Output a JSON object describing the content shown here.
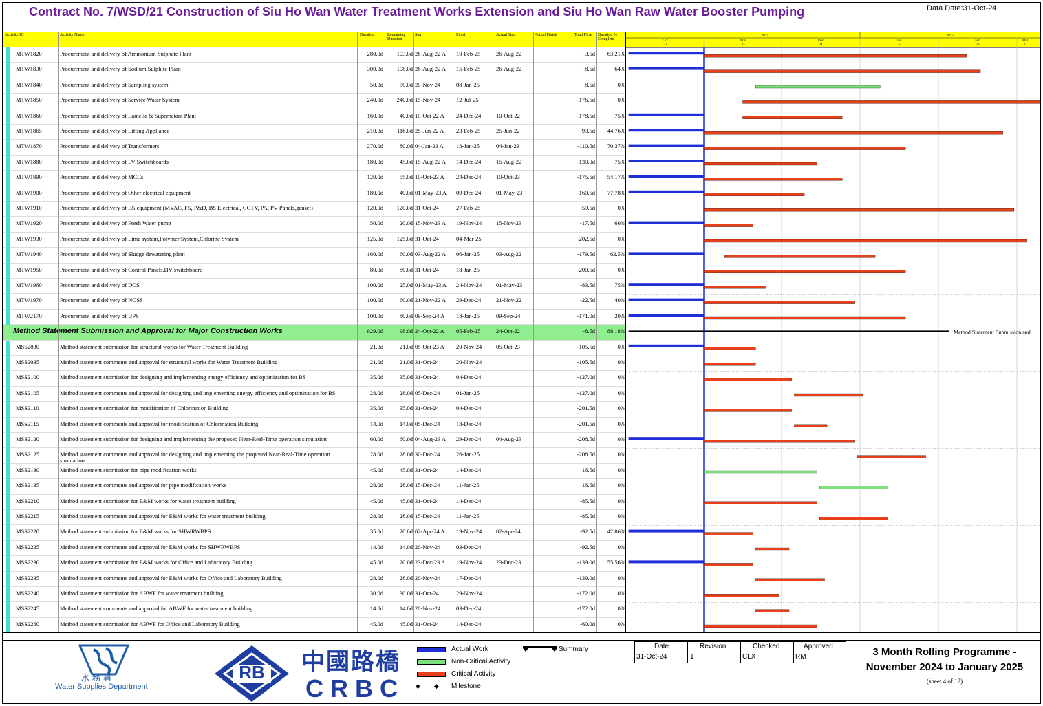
{
  "title": "Contract No. 7/WSD/21 Construction of Siu Ho Wan Water Treatment Works Extension and Siu Ho Wan Raw Water Booster Pumping",
  "data_date": "Data Date:31-Oct-24",
  "columns": [
    "Activity ID",
    "Activity Name",
    "Duration",
    "Remaining Duration",
    "Start",
    "Finish",
    "Actual Start",
    "Actual Finish",
    "Total Float",
    "Duration % Complete"
  ],
  "timescale": {
    "years": [
      "2024",
      "2025"
    ],
    "months": [
      "Oct",
      "Nov",
      "Dec",
      "Jan",
      "Feb",
      "Mar"
    ],
    "weeks": [
      "32",
      "33",
      "34",
      "35",
      "36",
      "37"
    ],
    "month_edges": [
      "30-Sep-24",
      "31-Oct-24",
      "30-Nov-24",
      "31-Dec-24",
      "31-Jan-25",
      "28-Feb-25",
      "31-Mar-25"
    ]
  },
  "rows": [
    {
      "id": "MTW1820",
      "name": "Procurement and delivery of Ammonium Sulphate Plant",
      "dur": "280.0d",
      "rem": "103.0d",
      "start": "26-Aug-22 A",
      "finish": "10-Feb-25",
      "astart": "26-Aug-22",
      "afin": "",
      "float": "-3.5d",
      "pct": "63.21%",
      "a_start": "1-Oct-24",
      "a_end": "31-Oct-24",
      "b_start": "31-Oct-24",
      "b_end": "10-Feb-25",
      "kind": "critical"
    },
    {
      "id": "MTW1830",
      "name": "Procurement and delivery of Sodium Sulphite Plant",
      "dur": "300.0d",
      "rem": "108.0d",
      "start": "26-Aug-22 A",
      "finish": "15-Feb-25",
      "astart": "26-Aug-22",
      "afin": "",
      "float": "-8.5d",
      "pct": "64%",
      "a_start": "1-Oct-24",
      "a_end": "31-Oct-24",
      "b_start": "31-Oct-24",
      "b_end": "15-Feb-25",
      "kind": "critical"
    },
    {
      "id": "MTW1840",
      "name": "Procurement and delivery of Sampling system",
      "dur": "50.0d",
      "rem": "50.0d",
      "start": "20-Nov-24",
      "finish": "08-Jan-25",
      "astart": "",
      "afin": "",
      "float": "8.5d",
      "pct": "0%",
      "a_start": "",
      "a_end": "",
      "b_start": "20-Nov-24",
      "b_end": "08-Jan-25",
      "kind": "noncritical"
    },
    {
      "id": "MTW1850",
      "name": "Procurement and delivery of Service Water System",
      "dur": "240.0d",
      "rem": "240.0d",
      "start": "15-Nov-24",
      "finish": "12-Jul-25",
      "astart": "",
      "afin": "",
      "float": "-176.5d",
      "pct": "0%",
      "a_start": "",
      "a_end": "",
      "b_start": "15-Nov-24",
      "b_end": "12-Jul-25",
      "kind": "critical"
    },
    {
      "id": "MTW1860",
      "name": "Procurement and delivery of Lamella & Supernatant Plant",
      "dur": "160.0d",
      "rem": "40.0d",
      "start": "10-Oct-22 A",
      "finish": "24-Dec-24",
      "astart": "10-Oct-22",
      "afin": "",
      "float": "-178.5d",
      "pct": "75%",
      "a_start": "1-Oct-24",
      "a_end": "31-Oct-24",
      "b_start": "15-Nov-24",
      "b_end": "24-Dec-24",
      "kind": "critical"
    },
    {
      "id": "MTW1865",
      "name": "Procurement and delivery of Lifting Appliance",
      "dur": "210.0d",
      "rem": "116.0d",
      "start": "25-Jun-22 A",
      "finish": "23-Feb-25",
      "astart": "25-Jun-22",
      "afin": "",
      "float": "-93.5d",
      "pct": "44.76%",
      "a_start": "1-Oct-24",
      "a_end": "31-Oct-24",
      "b_start": "31-Oct-24",
      "b_end": "23-Feb-25",
      "kind": "critical"
    },
    {
      "id": "MTW1870",
      "name": "Procurement and delivery of Transformers",
      "dur": "270.0d",
      "rem": "80.0d",
      "start": "04-Jan-23 A",
      "finish": "18-Jan-25",
      "astart": "04-Jan-23",
      "afin": "",
      "float": "-110.5d",
      "pct": "70.37%",
      "a_start": "1-Oct-24",
      "a_end": "31-Oct-24",
      "b_start": "31-Oct-24",
      "b_end": "18-Jan-25",
      "kind": "critical"
    },
    {
      "id": "MTW1880",
      "name": "Procurement and delivery of LV Switchboards",
      "dur": "180.0d",
      "rem": "45.0d",
      "start": "15-Aug-22 A",
      "finish": "14-Dec-24",
      "astart": "15-Aug-22",
      "afin": "",
      "float": "-130.0d",
      "pct": "75%",
      "a_start": "1-Oct-24",
      "a_end": "31-Oct-24",
      "b_start": "31-Oct-24",
      "b_end": "14-Dec-24",
      "kind": "critical"
    },
    {
      "id": "MTW1890",
      "name": "Procurement and delivery of MCCs",
      "dur": "120.0d",
      "rem": "55.0d",
      "start": "10-Oct-23 A",
      "finish": "24-Dec-24",
      "astart": "10-Oct-23",
      "afin": "",
      "float": "-175.5d",
      "pct": "54.17%",
      "a_start": "1-Oct-24",
      "a_end": "31-Oct-24",
      "b_start": "31-Oct-24",
      "b_end": "24-Dec-24",
      "kind": "critical"
    },
    {
      "id": "MTW1900",
      "name": "Procurement and delivery of Other electrical equipment",
      "dur": "180.0d",
      "rem": "40.0d",
      "start": "01-May-23 A",
      "finish": "09-Dec-24",
      "astart": "01-May-23",
      "afin": "",
      "float": "-160.5d",
      "pct": "77.78%",
      "a_start": "1-Oct-24",
      "a_end": "31-Oct-24",
      "b_start": "31-Oct-24",
      "b_end": "09-Dec-24",
      "kind": "critical"
    },
    {
      "id": "MTW1910",
      "name": "Procurement and delivery of BS equipment (MVAC, FS, P&D, BS Electrical, CCTV, PA, PV Panels,genset)",
      "dur": "120.0d",
      "rem": "120.0d",
      "start": "31-Oct-24",
      "finish": "27-Feb-25",
      "astart": "",
      "afin": "",
      "float": "-59.5d",
      "pct": "0%",
      "a_start": "",
      "a_end": "",
      "b_start": "31-Oct-24",
      "b_end": "27-Feb-25",
      "kind": "critical"
    },
    {
      "id": "MTW1920",
      "name": "Procurement and delivery of Fresh Water pump",
      "dur": "50.0d",
      "rem": "20.0d",
      "start": "15-Nov-23 A",
      "finish": "19-Nov-24",
      "astart": "15-Nov-23",
      "afin": "",
      "float": "-17.5d",
      "pct": "60%",
      "a_start": "1-Oct-24",
      "a_end": "31-Oct-24",
      "b_start": "31-Oct-24",
      "b_end": "19-Nov-24",
      "kind": "critical"
    },
    {
      "id": "MTW1930",
      "name": "Procurement and delivery of Lime system,Polymer System,Chlorine System",
      "dur": "125.0d",
      "rem": "125.0d",
      "start": "31-Oct-24",
      "finish": "04-Mar-25",
      "astart": "",
      "afin": "",
      "float": "-202.5d",
      "pct": "0%",
      "a_start": "",
      "a_end": "",
      "b_start": "31-Oct-24",
      "b_end": "04-Mar-25",
      "kind": "critical"
    },
    {
      "id": "MTW1940",
      "name": "Procurement and delivery of Sludge dewatering plant",
      "dur": "160.0d",
      "rem": "60.0d",
      "start": "03-Aug-22 A",
      "finish": "06-Jan-25",
      "astart": "03-Aug-22",
      "afin": "",
      "float": "-179.5d",
      "pct": "62.5%",
      "a_start": "1-Oct-24",
      "a_end": "31-Oct-24",
      "b_start": "08-Nov-24",
      "b_end": "06-Jan-25",
      "kind": "critical"
    },
    {
      "id": "MTW1950",
      "name": "Procurement and delivery of Control Panels,HV switchboard",
      "dur": "80.0d",
      "rem": "80.0d",
      "start": "31-Oct-24",
      "finish": "18-Jan-25",
      "astart": "",
      "afin": "",
      "float": "-200.5d",
      "pct": "0%",
      "a_start": "",
      "a_end": "",
      "b_start": "31-Oct-24",
      "b_end": "18-Jan-25",
      "kind": "critical"
    },
    {
      "id": "MTW1960",
      "name": "Procurement and delivery of DCS",
      "dur": "100.0d",
      "rem": "25.0d",
      "start": "01-May-23 A",
      "finish": "24-Nov-24",
      "astart": "01-May-23",
      "afin": "",
      "float": "-83.5d",
      "pct": "75%",
      "a_start": "1-Oct-24",
      "a_end": "31-Oct-24",
      "b_start": "31-Oct-24",
      "b_end": "24-Nov-24",
      "kind": "critical"
    },
    {
      "id": "MTW1970",
      "name": "Procurement and delivery of NOSS",
      "dur": "100.0d",
      "rem": "60.0d",
      "start": "21-Nov-22 A",
      "finish": "29-Dec-24",
      "astart": "21-Nov-22",
      "afin": "",
      "float": "-22.5d",
      "pct": "40%",
      "a_start": "1-Oct-24",
      "a_end": "31-Oct-24",
      "b_start": "31-Oct-24",
      "b_end": "29-Dec-24",
      "kind": "critical"
    },
    {
      "id": "MTW2170",
      "name": "Procurement and delivery of UPS",
      "dur": "100.0d",
      "rem": "80.0d",
      "start": "09-Sep-24 A",
      "finish": "18-Jan-25",
      "astart": "09-Sep-24",
      "afin": "",
      "float": "-171.0d",
      "pct": "20%",
      "a_start": "1-Oct-24",
      "a_end": "31-Oct-24",
      "b_start": "31-Oct-24",
      "b_end": "18-Jan-25",
      "kind": "critical"
    },
    {
      "id": "",
      "name": "Method Statement Submission and Approval for Major Construction Works",
      "dur": "829.0d",
      "rem": "98.0d",
      "start": "24-Oct-22 A",
      "finish": "05-Feb-25",
      "astart": "24-Oct-22",
      "afin": "",
      "float": "-8.5d",
      "pct": "88.18%",
      "a_start": "",
      "a_end": "",
      "b_start": "1-Oct-24",
      "b_end": "31-Mar-25",
      "kind": "summary",
      "label": "Method Statement Submission and"
    },
    {
      "id": "MSS2030",
      "name": "Method statement submission for structural works for Water Treatment Building",
      "dur": "21.0d",
      "rem": "21.0d",
      "start": "05-Oct-23 A",
      "finish": "20-Nov-24",
      "astart": "05-Oct-23",
      "afin": "",
      "float": "-105.5d",
      "pct": "0%",
      "a_start": "1-Oct-24",
      "a_end": "31-Oct-24",
      "b_start": "31-Oct-24",
      "b_end": "20-Nov-24",
      "kind": "critical"
    },
    {
      "id": "MSS2035",
      "name": "Method statement comments and approval for structural works for Water Treatment Building",
      "dur": "21.0d",
      "rem": "21.0d",
      "start": "31-Oct-24",
      "finish": "20-Nov-24",
      "astart": "",
      "afin": "",
      "float": "-105.5d",
      "pct": "0%",
      "a_start": "",
      "a_end": "",
      "b_start": "31-Oct-24",
      "b_end": "20-Nov-24",
      "kind": "critical"
    },
    {
      "id": "MSS2100",
      "name": "Method statement submission for designing and implementing energy efficiency and optimization for BS",
      "dur": "35.0d",
      "rem": "35.0d",
      "start": "31-Oct-24",
      "finish": "04-Dec-24",
      "astart": "",
      "afin": "",
      "float": "-127.0d",
      "pct": "0%",
      "a_start": "",
      "a_end": "",
      "b_start": "31-Oct-24",
      "b_end": "04-Dec-24",
      "kind": "critical"
    },
    {
      "id": "MSS2105",
      "name": "Method statement comments and approval for designing and implementing energy efficiency and optimization for BS",
      "dur": "28.0d",
      "rem": "28.0d",
      "start": "05-Dec-24",
      "finish": "01-Jan-25",
      "astart": "",
      "afin": "",
      "float": "-127.0d",
      "pct": "0%",
      "a_start": "",
      "a_end": "",
      "b_start": "05-Dec-24",
      "b_end": "01-Jan-25",
      "kind": "critical"
    },
    {
      "id": "MSS2110",
      "name": "Method statement submission for modification of Chlorination Building",
      "dur": "35.0d",
      "rem": "35.0d",
      "start": "31-Oct-24",
      "finish": "04-Dec-24",
      "astart": "",
      "afin": "",
      "float": "-201.5d",
      "pct": "0%",
      "a_start": "",
      "a_end": "",
      "b_start": "31-Oct-24",
      "b_end": "04-Dec-24",
      "kind": "critical"
    },
    {
      "id": "MSS2115",
      "name": "Method statement  comments and approval for modification of Chlorination Building",
      "dur": "14.0d",
      "rem": "14.0d",
      "start": "05-Dec-24",
      "finish": "18-Dec-24",
      "astart": "",
      "afin": "",
      "float": "-201.5d",
      "pct": "0%",
      "a_start": "",
      "a_end": "",
      "b_start": "05-Dec-24",
      "b_end": "18-Dec-24",
      "kind": "critical"
    },
    {
      "id": "MSS2120",
      "name": "Method statement submission for designing and implementing the proposed Near-Real-Time operation simulation",
      "dur": "60.0d",
      "rem": "60.0d",
      "start": "04-Aug-23 A",
      "finish": "29-Dec-24",
      "astart": "04-Aug-23",
      "afin": "",
      "float": "-208.5d",
      "pct": "0%",
      "a_start": "1-Oct-24",
      "a_end": "31-Oct-24",
      "b_start": "31-Oct-24",
      "b_end": "29-Dec-24",
      "kind": "critical"
    },
    {
      "id": "MSS2125",
      "name": "Method statement comments and approval for designing and implementing the proposed Near-Real-Time operation",
      "name2": "simulation",
      "dur": "28.0d",
      "rem": "28.0d",
      "start": "30-Dec-24",
      "finish": "26-Jan-25",
      "astart": "",
      "afin": "",
      "float": "-208.5d",
      "pct": "0%",
      "a_start": "",
      "a_end": "",
      "b_start": "30-Dec-24",
      "b_end": "26-Jan-25",
      "kind": "critical"
    },
    {
      "id": "MSS2130",
      "name": "Method statement submission for pipe modification works",
      "dur": "45.0d",
      "rem": "45.0d",
      "start": "31-Oct-24",
      "finish": "14-Dec-24",
      "astart": "",
      "afin": "",
      "float": "16.5d",
      "pct": "0%",
      "a_start": "",
      "a_end": "",
      "b_start": "31-Oct-24",
      "b_end": "14-Dec-24",
      "kind": "noncritical"
    },
    {
      "id": "MSS2135",
      "name": "Method statement comments and approval for pipe modification works",
      "dur": "28.0d",
      "rem": "28.0d",
      "start": "15-Dec-24",
      "finish": "11-Jan-25",
      "astart": "",
      "afin": "",
      "float": "16.5d",
      "pct": "0%",
      "a_start": "",
      "a_end": "",
      "b_start": "15-Dec-24",
      "b_end": "11-Jan-25",
      "kind": "noncritical"
    },
    {
      "id": "MSS2210",
      "name": "Method statement submission for E&M works for water treatment building",
      "dur": "45.0d",
      "rem": "45.0d",
      "start": "31-Oct-24",
      "finish": "14-Dec-24",
      "astart": "",
      "afin": "",
      "float": "-85.5d",
      "pct": "0%",
      "a_start": "",
      "a_end": "",
      "b_start": "31-Oct-24",
      "b_end": "14-Dec-24",
      "kind": "critical"
    },
    {
      "id": "MSS2215",
      "name": "Method statement comments and approval for E&M works for water treatment building",
      "dur": "28.0d",
      "rem": "28.0d",
      "start": "15-Dec-24",
      "finish": "11-Jan-25",
      "astart": "",
      "afin": "",
      "float": "-85.5d",
      "pct": "0%",
      "a_start": "",
      "a_end": "",
      "b_start": "15-Dec-24",
      "b_end": "11-Jan-25",
      "kind": "critical"
    },
    {
      "id": "MSS2220",
      "name": "Method statement submission for E&M works for SHWRWBPS",
      "dur": "35.0d",
      "rem": "20.0d",
      "start": "02-Apr-24 A",
      "finish": "19-Nov-24",
      "astart": "02-Apr-24",
      "afin": "",
      "float": "-92.5d",
      "pct": "42.86%",
      "a_start": "1-Oct-24",
      "a_end": "31-Oct-24",
      "b_start": "31-Oct-24",
      "b_end": "19-Nov-24",
      "kind": "critical"
    },
    {
      "id": "MSS2225",
      "name": "Method statement comments and approval for E&M works for SHWRWBPS",
      "dur": "14.0d",
      "rem": "14.0d",
      "start": "20-Nov-24",
      "finish": "03-Dec-24",
      "astart": "",
      "afin": "",
      "float": "-92.5d",
      "pct": "0%",
      "a_start": "",
      "a_end": "",
      "b_start": "20-Nov-24",
      "b_end": "03-Dec-24",
      "kind": "critical"
    },
    {
      "id": "MSS2230",
      "name": "Method statement submission for E&M works for Office and Laboratory Building",
      "dur": "45.0d",
      "rem": "20.0d",
      "start": "23-Dec-23 A",
      "finish": "19-Nov-24",
      "astart": "23-Dec-23",
      "afin": "",
      "float": "-139.0d",
      "pct": "55.56%",
      "a_start": "1-Oct-24",
      "a_end": "31-Oct-24",
      "b_start": "31-Oct-24",
      "b_end": "19-Nov-24",
      "kind": "critical"
    },
    {
      "id": "MSS2235",
      "name": "Method statement comments and approval for E&M works for Office and Laboratory Building",
      "dur": "28.0d",
      "rem": "28.0d",
      "start": "20-Nov-24",
      "finish": "17-Dec-24",
      "astart": "",
      "afin": "",
      "float": "-139.0d",
      "pct": "0%",
      "a_start": "",
      "a_end": "",
      "b_start": "20-Nov-24",
      "b_end": "17-Dec-24",
      "kind": "critical"
    },
    {
      "id": "MSS2240",
      "name": "Method statement submission for ABWF for water treatment building",
      "dur": "30.0d",
      "rem": "30.0d",
      "start": "31-Oct-24",
      "finish": "29-Nov-24",
      "astart": "",
      "afin": "",
      "float": "-172.0d",
      "pct": "0%",
      "a_start": "",
      "a_end": "",
      "b_start": "31-Oct-24",
      "b_end": "29-Nov-24",
      "kind": "critical"
    },
    {
      "id": "MSS2245",
      "name": "Method statement comments and approval for ABWF for water treatment building",
      "dur": "14.0d",
      "rem": "14.0d",
      "start": "20-Nov-24",
      "finish": "03-Dec-24",
      "astart": "",
      "afin": "",
      "float": "-172.0d",
      "pct": "0%",
      "a_start": "",
      "a_end": "",
      "b_start": "20-Nov-24",
      "b_end": "03-Dec-24",
      "kind": "critical"
    },
    {
      "id": "MSS2260",
      "name": "Method statement submission for ABWF for Office and Laboratory Building",
      "dur": "45.0d",
      "rem": "45.0d",
      "start": "31-Oct-24",
      "finish": "14-Dec-24",
      "astart": "",
      "afin": "",
      "float": "-60.0d",
      "pct": "0%",
      "a_start": "",
      "a_end": "",
      "b_start": "31-Oct-24",
      "b_end": "14-Dec-24",
      "kind": "critical"
    }
  ],
  "colors": {
    "actual": "#1f2fd6",
    "noncritical": "#7de07d",
    "critical": "#e8401a",
    "summary": "#000000",
    "wbs_band": "#90ee90",
    "header": "#ffff00",
    "datadate_line": "#1f2fd6"
  },
  "legend": {
    "actual": "Actual Work",
    "noncritical": "Non-Critical Activity",
    "critical": "Critical Activity",
    "milestone": "Milestone",
    "summary": "Summary"
  },
  "approval": {
    "headers": [
      "Date",
      "Revision",
      "Checked",
      "Approved"
    ],
    "values": [
      "31-Oct-24",
      "1",
      "CLX",
      "RM"
    ]
  },
  "program_title": "3 Month Rolling Programme - November 2024 to January 2025",
  "sheet": "(sheet 4 of 12)",
  "logos": {
    "wsd_cn": "水務署",
    "wsd_en": "Water Supplies Department",
    "crbc_cn": "中國路橋",
    "crbc_en": "CRBC",
    "rb": "RB"
  }
}
